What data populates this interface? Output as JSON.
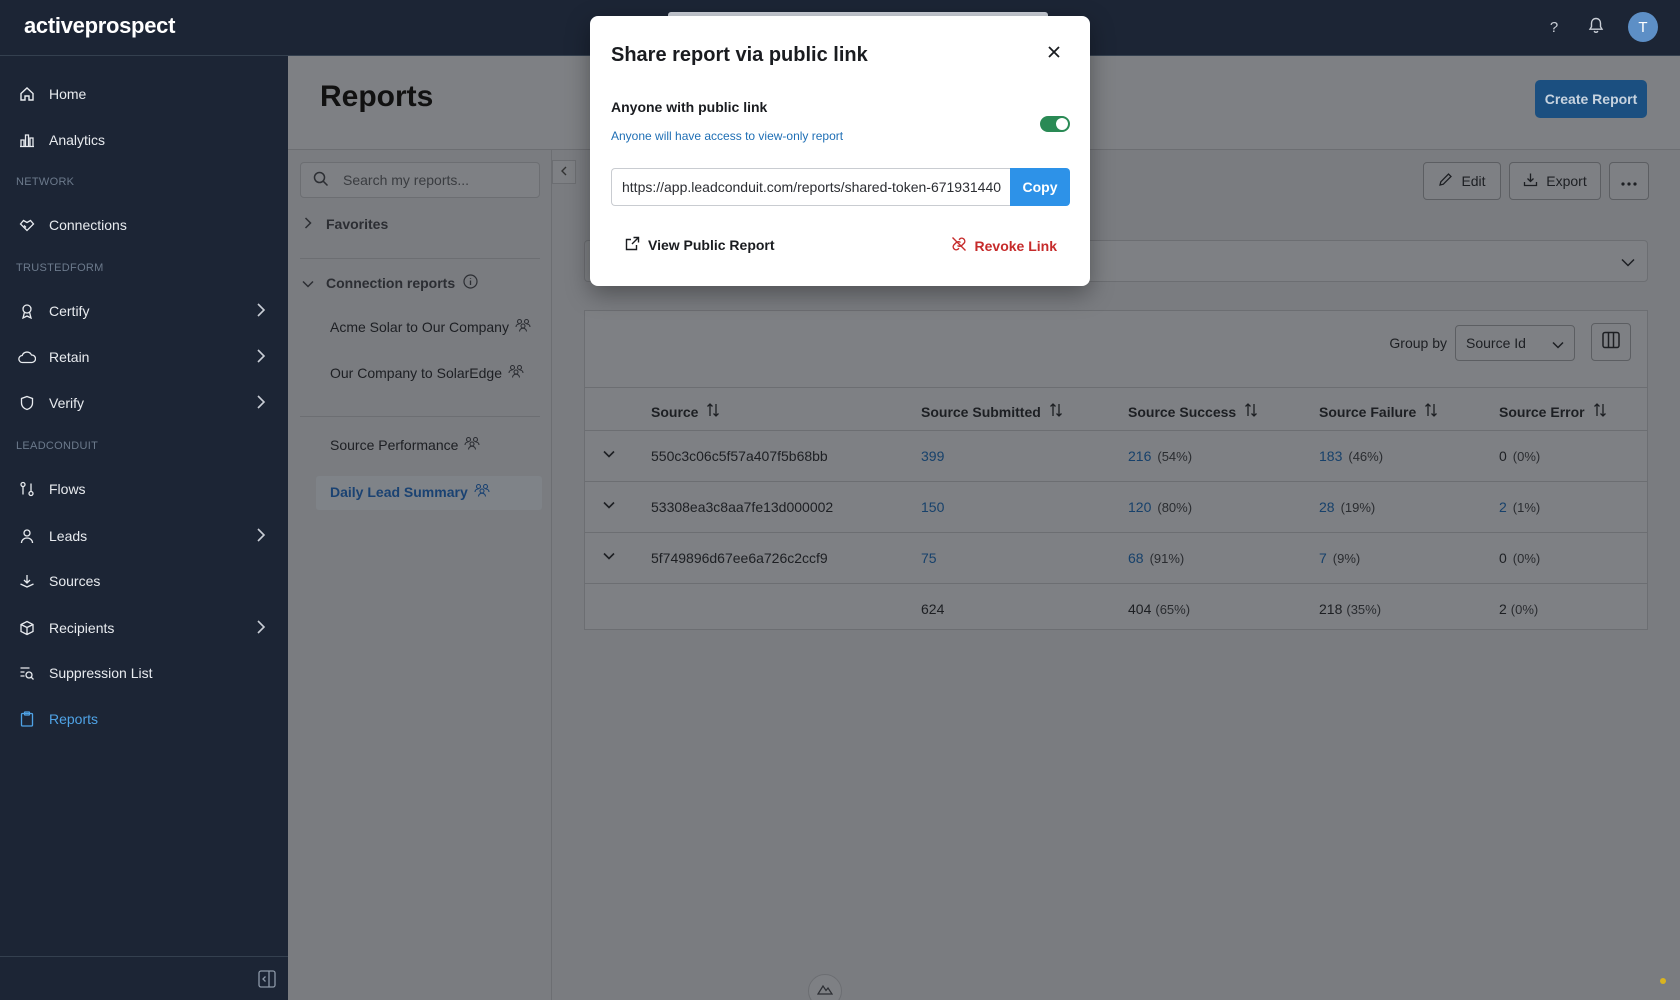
{
  "app": {
    "logo_text": "activeprospect",
    "help_icon": "?",
    "avatar_initial": "T"
  },
  "sidebar": {
    "items": [
      {
        "label": "Home",
        "icon": "home-icon"
      },
      {
        "label": "Analytics",
        "icon": "chart-icon"
      },
      {
        "label": "Connections",
        "icon": "handshake-icon"
      },
      {
        "label": "Certify",
        "icon": "ribbon-icon"
      },
      {
        "label": "Retain",
        "icon": "cloud-icon"
      },
      {
        "label": "Verify",
        "icon": "shield-icon"
      },
      {
        "label": "Flows",
        "icon": "flow-icon"
      },
      {
        "label": "Leads",
        "icon": "person-icon"
      },
      {
        "label": "Sources",
        "icon": "sources-icon"
      },
      {
        "label": "Recipients",
        "icon": "box-icon"
      },
      {
        "label": "Suppression List",
        "icon": "list-search-icon"
      },
      {
        "label": "Reports",
        "icon": "clipboard-icon"
      }
    ],
    "sections": {
      "network": "NETWORK",
      "trustedform": "TRUSTEDFORM",
      "leadconduit": "LEADCONDUIT"
    }
  },
  "page": {
    "title": "Reports",
    "create_button": "Create Report"
  },
  "reports_panel": {
    "search_placeholder": "Search my reports...",
    "favorites_label": "Favorites",
    "connection_reports_label": "Connection reports",
    "connection_reports": [
      "Acme Solar to Our Company",
      "Our Company to SolarEdge"
    ],
    "reports": [
      "Source Performance",
      "Daily Lead Summary"
    ]
  },
  "toolbar": {
    "edit": "Edit",
    "export": "Export"
  },
  "table": {
    "group_by_label": "Group by",
    "group_by_value": "Source Id",
    "columns": [
      "Source",
      "Source Submitted",
      "Source Success",
      "Source Failure",
      "Source Error"
    ],
    "rows": [
      {
        "source": "550c3c06c5f57a407f5b68bb",
        "submitted": "399",
        "success": "216",
        "success_pct": "(54%)",
        "failure": "183",
        "failure_pct": "(46%)",
        "error": "0",
        "error_pct": "(0%)"
      },
      {
        "source": "53308ea3c8aa7fe13d000002",
        "submitted": "150",
        "success": "120",
        "success_pct": "(80%)",
        "failure": "28",
        "failure_pct": "(19%)",
        "error": "2",
        "error_pct": "(1%)"
      },
      {
        "source": "5f749896d67ee6a726c2ccf9",
        "submitted": "75",
        "success": "68",
        "success_pct": "(91%)",
        "failure": "7",
        "failure_pct": "(9%)",
        "error": "0",
        "error_pct": "(0%)"
      }
    ],
    "totals": {
      "submitted": "624",
      "success": "404",
      "success_pct": "(65%)",
      "failure": "218",
      "failure_pct": "(35%)",
      "error": "2",
      "error_pct": "(0%)"
    }
  },
  "modal": {
    "title": "Share report via public link",
    "subtitle": "Anyone with public link",
    "help": "Anyone will have access to view-only report",
    "toggle_on": true,
    "url": "https://app.leadconduit.com/reports/shared-token-671931440",
    "copy_label": "Copy",
    "view_public_label": "View Public Report",
    "revoke_label": "Revoke Link"
  },
  "colors": {
    "sidebar_bg": "#1c2535",
    "accent": "#2d92e8",
    "danger": "#c62b2b",
    "toggle_on": "#2a8a55"
  }
}
